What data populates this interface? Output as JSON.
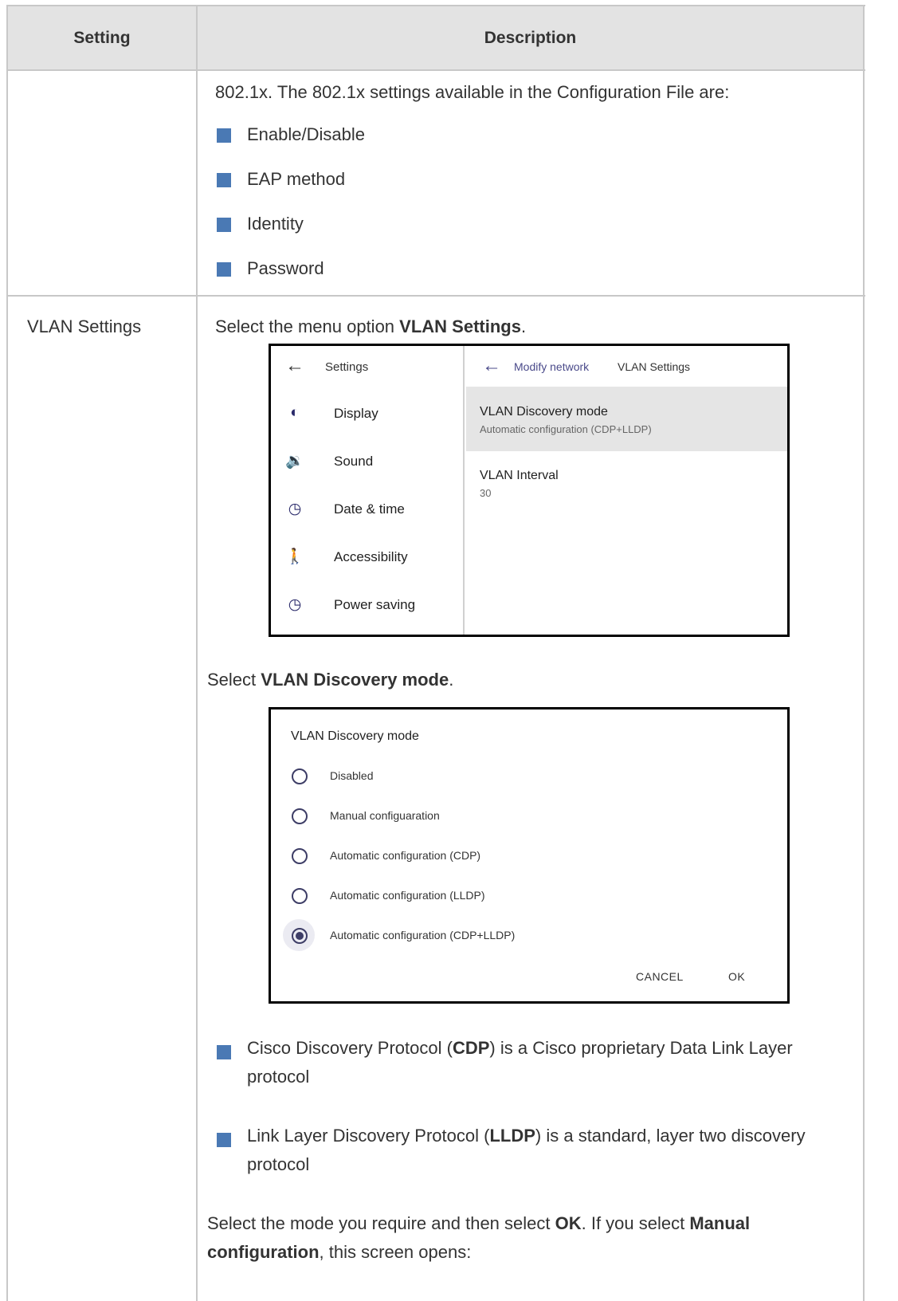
{
  "table": {
    "headers": {
      "setting": "Setting",
      "description": "Description"
    },
    "row1": {
      "intro": "802.1x. The 802.1x settings available in the Configuration File are:",
      "bullets": [
        "Enable/Disable",
        "EAP method",
        "Identity",
        "Password"
      ]
    },
    "row2": {
      "setting": "VLAN Settings",
      "step1": {
        "pre": "Select the menu option ",
        "bold": "VLAN Settings",
        "post": "."
      },
      "step2": {
        "pre": "Select ",
        "bold": "VLAN Discovery mode",
        "post": "."
      },
      "bullet1": {
        "pre": "Cisco Discovery Protocol (",
        "bold": "CDP",
        "post": ") is a Cisco proprietary Data Link Layer protocol"
      },
      "bullet2": {
        "pre": "Link Layer Discovery Protocol (",
        "bold": "LLDP",
        "post": ") is a standard, layer two discovery protocol"
      },
      "final": {
        "p1": "Select the mode you require and then select ",
        "b1": "OK",
        "p2": ". If you select ",
        "b2": "Manual configuration",
        "p3": ", this screen opens:"
      }
    }
  },
  "screenshot1": {
    "left_header": "Settings",
    "menu": [
      {
        "label": "Display",
        "icon": "brightness-icon"
      },
      {
        "label": "Sound",
        "icon": "speaker-icon"
      },
      {
        "label": "Date & time",
        "icon": "clock-icon"
      },
      {
        "label": "Accessibility",
        "icon": "accessibility-icon"
      },
      {
        "label": "Power saving",
        "icon": "clock-icon"
      }
    ],
    "right_header": {
      "back": "Modify network",
      "current": "VLAN Settings"
    },
    "items": [
      {
        "title": "VLAN Discovery mode",
        "value": "Automatic configuration (CDP+LLDP)"
      },
      {
        "title": "VLAN Interval",
        "value": "30"
      }
    ]
  },
  "screenshot2": {
    "title": "VLAN Discovery mode",
    "options": [
      "Disabled",
      "Manual configuaration",
      "Automatic configuration (CDP)",
      "Automatic configuration (LLDP)",
      "Automatic configuration (CDP+LLDP)"
    ],
    "selected_index": 4,
    "cancel": "CANCEL",
    "ok": "OK"
  },
  "colors": {
    "bullet": "#4a79b4",
    "header_bg": "#e3e3e3",
    "border": "#c8c8c8"
  }
}
